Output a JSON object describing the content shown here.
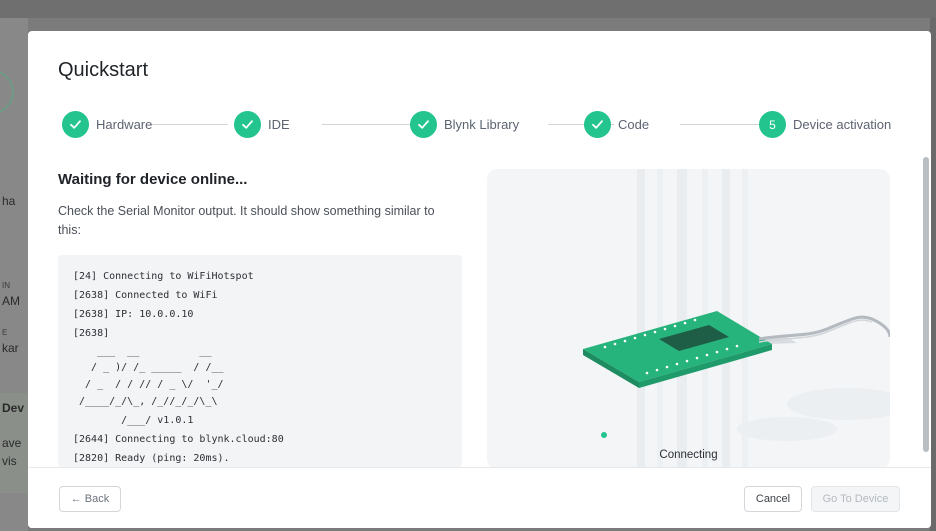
{
  "background": {
    "fragments": [
      "ha",
      "IN",
      "AM",
      "E",
      "kar",
      "Dev",
      "ave",
      "vis"
    ]
  },
  "modal": {
    "title": "Quickstart",
    "steps": [
      {
        "status": "complete",
        "label": "Hardware"
      },
      {
        "status": "complete",
        "label": "IDE"
      },
      {
        "status": "complete",
        "label": "Blynk Library"
      },
      {
        "status": "complete",
        "label": "Code"
      },
      {
        "status": "active",
        "number": "5",
        "label": "Device activation"
      }
    ],
    "heading": "Waiting for device online...",
    "description": "Check the Serial Monitor output. It should show something similar to this:",
    "serial_output": [
      "[24] Connecting to WiFiHotspot",
      "[2638] Connected to WiFi",
      "[2638] IP: 10.0.0.10",
      "[2638]",
      "    ___  __          __",
      "   / _ )/ /_ _____  / /__",
      "  / _  / / // / _ \\/  '_/",
      " /____/_/\\_, /_//_/_/\\_\\",
      "        /___/ v1.0.1",
      "[2644] Connecting to blynk.cloud:80",
      "[2820] Ready (ping: 20ms)."
    ],
    "illustration_status": "Connecting",
    "footer": {
      "back_label": "← Back",
      "cancel_label": "Cancel",
      "go_label": "Go To Device"
    }
  },
  "colors": {
    "accent": "#23c48e",
    "overlay": "#6f6f6f"
  },
  "icons": {
    "step_complete": "check-icon",
    "back": "arrow-left-icon"
  }
}
